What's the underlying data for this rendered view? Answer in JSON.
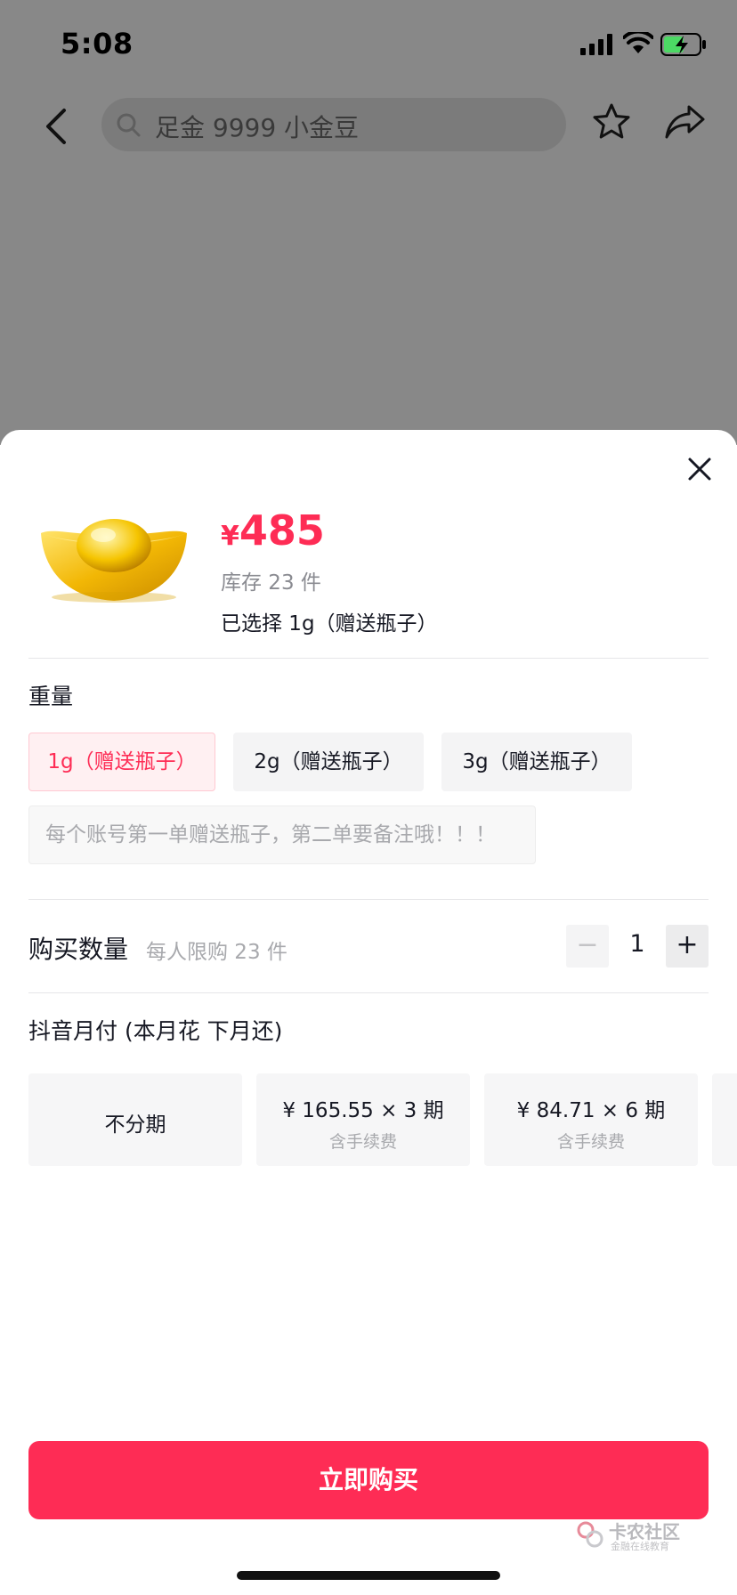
{
  "status_bar": {
    "time": "5:08"
  },
  "nav": {
    "search_text": "足金 9999 小金豆"
  },
  "product": {
    "price_symbol": "¥",
    "price": "485",
    "stock": "库存 23 件",
    "selected": "已选择 1g（赠送瓶子）"
  },
  "weight": {
    "label": "重量",
    "options": [
      "1g（赠送瓶子）",
      "2g（赠送瓶子）",
      "3g（赠送瓶子）"
    ],
    "selected_index": 0,
    "note": "每个账号第一单赠送瓶子，第二单要备注哦！！！"
  },
  "quantity": {
    "label": "购买数量",
    "limit": "每人限购 23 件",
    "value": "1",
    "minus": "−",
    "plus": "+"
  },
  "payment": {
    "label": "抖音月付 (本月花 下月还)",
    "options": [
      {
        "main": "不分期",
        "sub": ""
      },
      {
        "main": "¥ 165.55 × 3 期",
        "sub": "含手续费"
      },
      {
        "main": "¥ 84.71 × 6 期",
        "sub": "含手续费"
      }
    ]
  },
  "buy_button": "立即购买",
  "watermark": {
    "title": "卡农社区",
    "subtitle": "金融在线教育"
  },
  "colors": {
    "accent": "#fe2c55",
    "backdrop": "#888888"
  }
}
